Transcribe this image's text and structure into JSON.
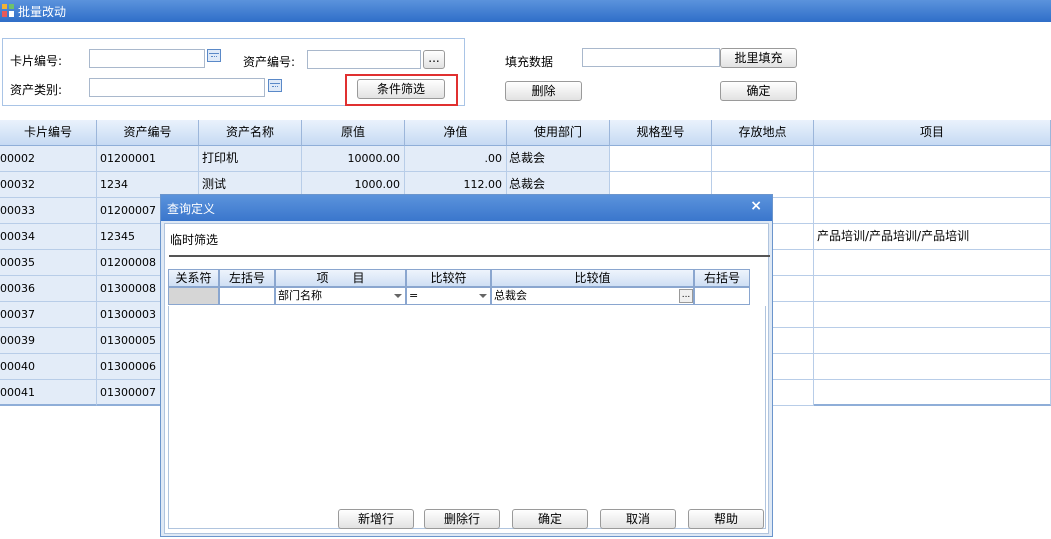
{
  "window": {
    "title": "批量改动"
  },
  "filter": {
    "card_no_label": "卡片编号:",
    "asset_no_label": "资产编号:",
    "asset_type_label": "资产类别:",
    "card_no_value": "",
    "asset_no_value": "",
    "asset_type_value": "",
    "condition_filter_button": "条件筛选",
    "ellipsis": "..."
  },
  "fill": {
    "fill_data_label": "填充数据",
    "fill_value": "",
    "batch_fill_button": "批里填充",
    "delete_button": "删除",
    "ok_button": "确定"
  },
  "grid": {
    "columns": [
      "卡片编号",
      "资产编号",
      "资产名称",
      "原值",
      "净值",
      "使用部门",
      "规格型号",
      "存放地点",
      "项目"
    ],
    "rows": [
      [
        "00002",
        "01200001",
        "打印机",
        "10000.00",
        ".00",
        "总裁会",
        "",
        "",
        ""
      ],
      [
        "00032",
        "1234",
        "测试",
        "1000.00",
        "112.00",
        "总裁会",
        "",
        "",
        ""
      ],
      [
        "00033",
        "01200007",
        "",
        "",
        "",
        "",
        "",
        "",
        ""
      ],
      [
        "00034",
        "12345",
        "",
        "",
        "",
        "",
        "",
        "",
        "产品培训/产品培训/产品培训"
      ],
      [
        "00035",
        "01200008",
        "",
        "",
        "",
        "",
        "",
        "",
        ""
      ],
      [
        "00036",
        "01300008",
        "",
        "",
        "",
        "",
        "",
        "",
        ""
      ],
      [
        "00037",
        "01300003",
        "",
        "",
        "",
        "",
        "",
        "",
        ""
      ],
      [
        "00039",
        "01300005",
        "",
        "",
        "",
        "",
        "",
        "",
        ""
      ],
      [
        "00040",
        "01300006",
        "",
        "",
        "",
        "",
        "",
        "",
        ""
      ],
      [
        "00041",
        "01300007",
        "",
        "",
        "",
        "",
        "",
        "",
        ""
      ]
    ]
  },
  "dialog": {
    "title": "查询定义",
    "close": "×",
    "section_label": "临时筛选",
    "columns": [
      "关系符",
      "左括号",
      "项　　目",
      "比较符",
      "比较值",
      "右括号"
    ],
    "row": {
      "relation": "",
      "left_paren": "",
      "item": "部门名称",
      "operator": "=",
      "value": "总裁会",
      "right_paren": ""
    },
    "buttons": {
      "add_row": "新增行",
      "delete_row": "删除行",
      "ok": "确定",
      "cancel": "取消",
      "help": "帮助"
    }
  },
  "colors": {
    "title_bar": "#3a76cc",
    "grid_header": "#c6daf3",
    "highlight": "#e03030"
  }
}
